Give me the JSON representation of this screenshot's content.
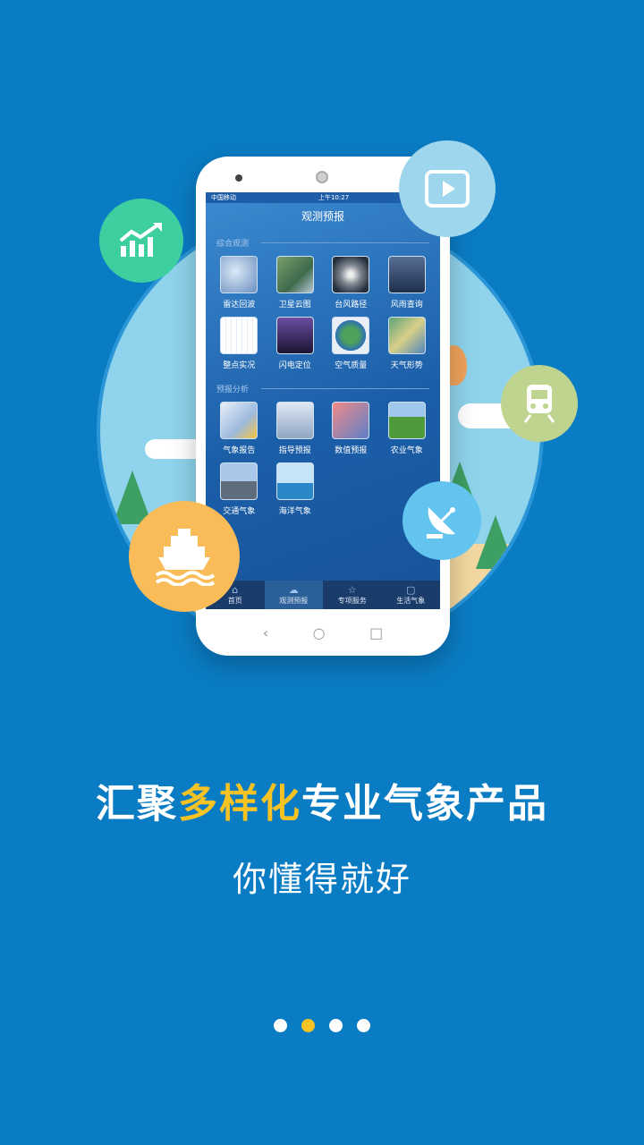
{
  "colors": {
    "background": "#0a7cc4",
    "accent": "#f7c324"
  },
  "phone": {
    "status_carrier": "中国移动",
    "status_time": "上午10:27",
    "title": "观测预报",
    "sections": [
      {
        "label": "综合观测",
        "items": [
          {
            "label": "雷达回波",
            "icon": "radar-thumb"
          },
          {
            "label": "卫星云图",
            "icon": "satellite-thumb"
          },
          {
            "label": "台风路径",
            "icon": "typhoon-thumb"
          },
          {
            "label": "风雨查询",
            "icon": "storm-thumb"
          },
          {
            "label": "整点实况",
            "icon": "chart-thumb"
          },
          {
            "label": "闪电定位",
            "icon": "lightning-thumb"
          },
          {
            "label": "空气质量",
            "icon": "earth-thumb"
          },
          {
            "label": "天气形势",
            "icon": "map-thumb"
          }
        ]
      },
      {
        "label": "预报分析",
        "items": [
          {
            "label": "气象报告",
            "icon": "report-thumb"
          },
          {
            "label": "指导预报",
            "icon": "guide-thumb"
          },
          {
            "label": "数值预报",
            "icon": "numeric-thumb"
          },
          {
            "label": "农业气象",
            "icon": "farm-thumb"
          },
          {
            "label": "交通气象",
            "icon": "traffic-thumb"
          },
          {
            "label": "海洋气象",
            "icon": "ocean-thumb"
          }
        ]
      }
    ],
    "tabs": [
      {
        "label": "首页",
        "icon": "home-icon"
      },
      {
        "label": "观测预报",
        "icon": "cloud-icon"
      },
      {
        "label": "专项服务",
        "icon": "star-icon"
      },
      {
        "label": "生活气象",
        "icon": "bag-icon"
      }
    ]
  },
  "headline": {
    "part1": "汇聚",
    "highlight": "多样化",
    "part2": "专业气象产品"
  },
  "subline": "你懂得就好",
  "pagination": {
    "count": 4,
    "active_index": 1
  }
}
